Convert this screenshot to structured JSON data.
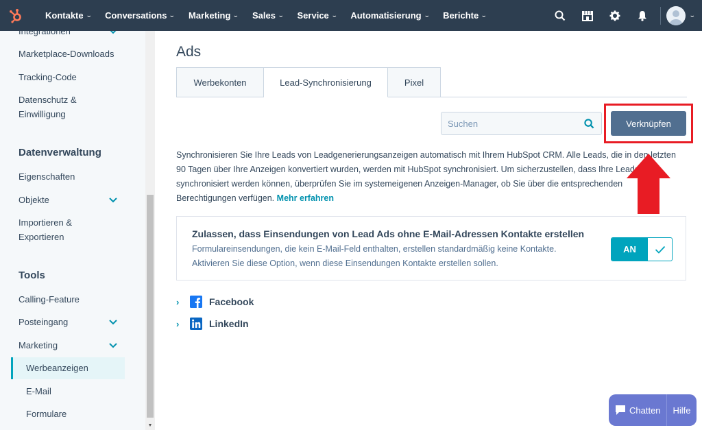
{
  "nav": {
    "items": [
      {
        "label": "Kontakte"
      },
      {
        "label": "Conversations"
      },
      {
        "label": "Marketing"
      },
      {
        "label": "Sales"
      },
      {
        "label": "Service"
      },
      {
        "label": "Automatisierung"
      },
      {
        "label": "Berichte"
      }
    ]
  },
  "sidebar": {
    "partial_item": "Integrationen",
    "marketplace": "Marketplace-Downloads",
    "tracking": "Tracking-Code",
    "datenschutz_1": "Datenschutz &",
    "datenschutz_2": "Einwilligung",
    "section_datenverwaltung": "Datenverwaltung",
    "eigenschaften": "Eigenschaften",
    "objekte": "Objekte",
    "import_1": "Importieren &",
    "import_2": "Exportieren",
    "section_tools": "Tools",
    "calling": "Calling-Feature",
    "posteingang": "Posteingang",
    "marketing": "Marketing",
    "werbeanzeigen": "Werbeanzeigen",
    "email": "E-Mail",
    "formulare": "Formulare"
  },
  "main": {
    "title": "Ads",
    "tabs": [
      {
        "label": "Werbekonten"
      },
      {
        "label": "Lead-Synchronisierung"
      },
      {
        "label": "Pixel"
      }
    ],
    "search_placeholder": "Suchen",
    "connect_button": "Verknüpfen",
    "description": "Synchronisieren Sie Ihre Leads von Leadgenerierungsanzeigen automatisch mit Ihrem HubSpot CRM. Alle Leads, die in den letzten 90 Tagen über Ihre Anzeigen konvertiert wurden, werden mit HubSpot synchronisiert. Um sicherzustellen, dass Ihre Leads synchronisiert werden können, überprüfen Sie im systemeigenen Anzeigen-Manager, ob Sie über die entsprechenden Berechtigungen verfügen.",
    "more_link": "Mehr erfahren",
    "card": {
      "title": "Zulassen, dass Einsendungen von Lead Ads ohne E-Mail-Adressen Kontakte erstellen",
      "text": "Formulareinsendungen, die kein E-Mail-Feld enthalten, erstellen standardmäßig keine Kontakte. Aktivieren Sie diese Option, wenn diese Einsendungen Kontakte erstellen sollen.",
      "toggle_label": "AN",
      "toggle_state": true
    },
    "accounts": [
      {
        "label": "Facebook",
        "color": "#1877f2"
      },
      {
        "label": "LinkedIn",
        "color": "#0a66c2"
      }
    ]
  },
  "chat": {
    "chat_label": "Chatten",
    "help_label": "Hilfe"
  },
  "colors": {
    "nav_bg": "#2d3e50",
    "accent": "#00a4bd",
    "button": "#516f90",
    "highlight": "#e81c24",
    "chat": "#6a78d1"
  }
}
